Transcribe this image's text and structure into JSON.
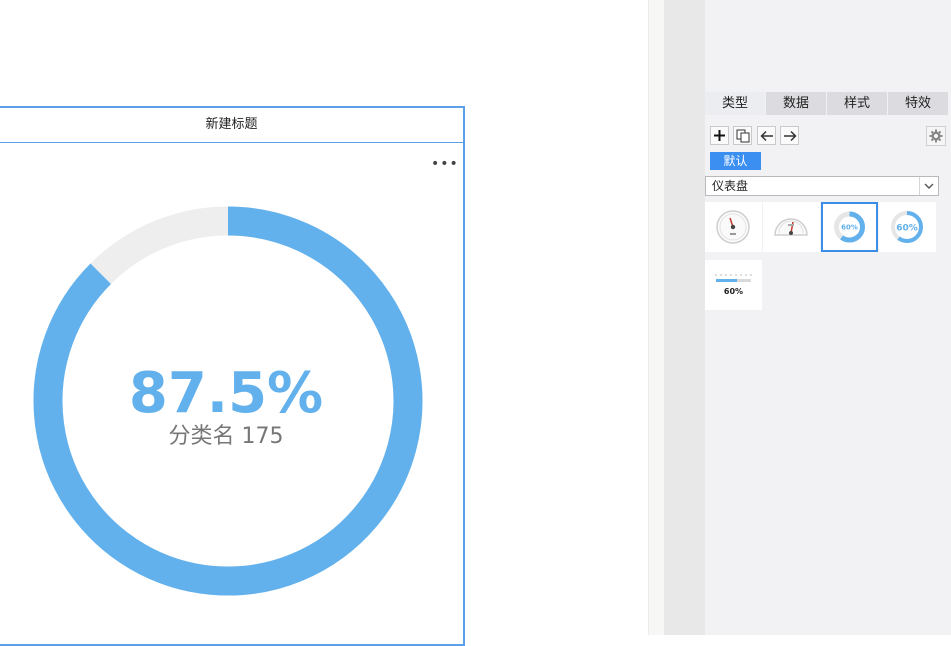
{
  "widget": {
    "title": "新建标题",
    "more_label": "•••"
  },
  "gauge": {
    "value_text": "87.5%",
    "fraction": 0.875,
    "label": "分类名 175",
    "progress_color": "#62b1ec",
    "track_color": "#eeeeee"
  },
  "panel": {
    "tabs": [
      {
        "label": "类型",
        "active": true
      },
      {
        "label": "数据",
        "active": false
      },
      {
        "label": "样式",
        "active": false
      },
      {
        "label": "特效",
        "active": false
      }
    ],
    "toolbar": {
      "add_icon": "plus-icon",
      "copy_icon": "copy-icon",
      "prev_icon": "arrow-left-icon",
      "next_icon": "arrow-right-icon",
      "settings_icon": "gear-icon"
    },
    "default_tag": "默认",
    "chart_type_select": {
      "value": "仪表盘"
    },
    "thumbnails": [
      {
        "type": "dial-gauge",
        "icon": "dial-gauge-icon",
        "text": ""
      },
      {
        "type": "semi-dial-gauge",
        "icon": "semicircle-gauge-icon",
        "text": ""
      },
      {
        "type": "ring-gauge",
        "icon": "ring-gauge-icon",
        "text": "60%",
        "selected": true
      },
      {
        "type": "arc-ring-gauge",
        "icon": "arc-gauge-icon",
        "text": "60%"
      },
      {
        "type": "bar-gauge",
        "icon": "bar-gauge-icon",
        "text": "60%"
      }
    ],
    "accent_color": "#3b8ff0"
  }
}
